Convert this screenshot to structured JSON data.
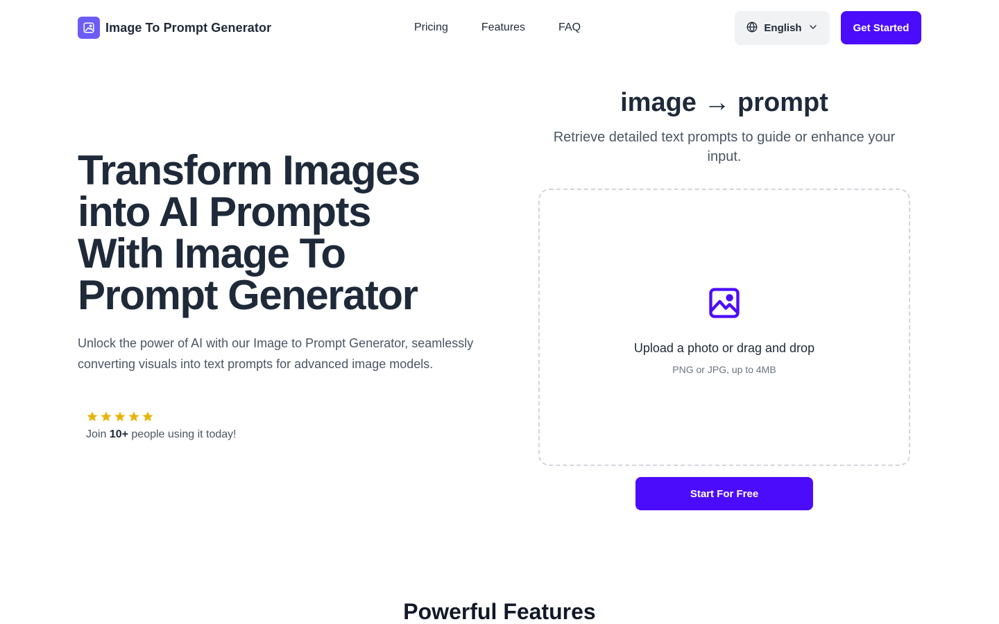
{
  "header": {
    "brand": "Image To Prompt Generator",
    "nav": [
      "Pricing",
      "Features",
      "FAQ"
    ],
    "language": "English",
    "cta": "Get Started"
  },
  "hero": {
    "title": "Transform Images into AI Prompts With Image To Prompt Generator",
    "subtitle": "Unlock the power of AI with our Image to Prompt Generator, seamlessly converting visuals into text prompts for advanced image models.",
    "rating": {
      "stars": 5,
      "prefix": "Join",
      "count": "10+",
      "suffix": "people using it today!"
    }
  },
  "tool": {
    "title": "image → prompt",
    "subtitle": "Retrieve detailed text prompts to guide or enhance your input.",
    "upload_label": "Upload a photo or drag and drop",
    "upload_hint": "PNG or JPG, up to 4MB",
    "start_button": "Start For Free"
  },
  "features": {
    "title": "Powerful Features"
  },
  "colors": {
    "accent": "#4c0cfc",
    "logo": "#6b5cf6",
    "star": "#eab308"
  },
  "icons": {
    "logo": "image-icon",
    "language": "globe-icon",
    "dropdown": "chevron-down-icon",
    "upload": "image-upload-icon",
    "star": "star-icon"
  }
}
